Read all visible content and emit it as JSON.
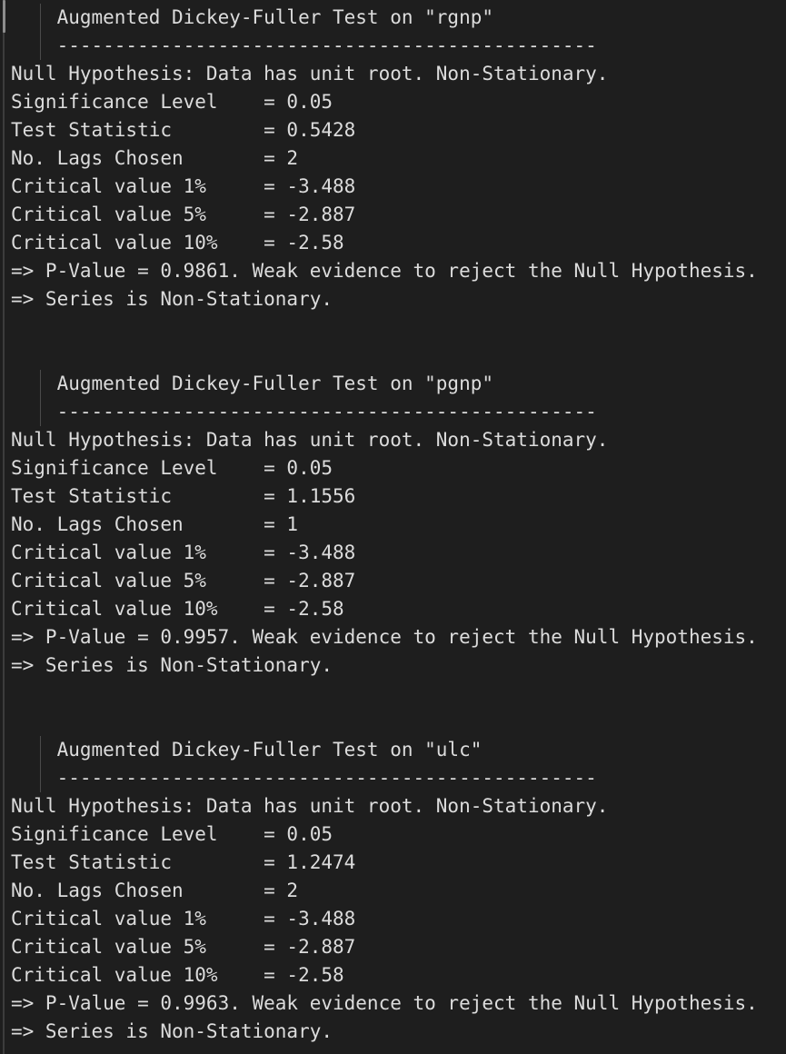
{
  "theme": {
    "background": "#1e1e1e",
    "text_color": "#dcdcdc",
    "rail_color": "#3c3c3c",
    "rail_active_color": "#8d8d8d",
    "guide_color": "#4a4a4a"
  },
  "output": {
    "blocks": [
      {
        "title": "    Augmented Dickey-Fuller Test on \"rgnp\"",
        "rule": "    -----------------------------------------------",
        "rows": [
          "Null Hypothesis: Data has unit root. Non-Stationary.",
          "Significance Level    = 0.05",
          "Test Statistic        = 0.5428",
          "No. Lags Chosen       = 2",
          "Critical value 1%     = -3.488",
          "Critical value 5%     = -2.887",
          "Critical value 10%    = -2.58",
          "=> P-Value = 0.9861. Weak evidence to reject the Null Hypothesis.",
          "=> Series is Non-Stationary."
        ],
        "fields": {
          "series": "rgnp",
          "null_hypothesis": "Data has unit root. Non-Stationary.",
          "significance_level": "0.05",
          "test_statistic": "0.5428",
          "no_lags_chosen": "2",
          "critical_value_1pct": "-3.488",
          "critical_value_5pct": "-2.887",
          "critical_value_10pct": "-2.58",
          "p_value": "0.9861",
          "conclusion_evidence": "Weak evidence to reject the Null Hypothesis.",
          "conclusion_series": "Series is Non-Stationary."
        }
      },
      {
        "title": "    Augmented Dickey-Fuller Test on \"pgnp\"",
        "rule": "    -----------------------------------------------",
        "rows": [
          "Null Hypothesis: Data has unit root. Non-Stationary.",
          "Significance Level    = 0.05",
          "Test Statistic        = 1.1556",
          "No. Lags Chosen       = 1",
          "Critical value 1%     = -3.488",
          "Critical value 5%     = -2.887",
          "Critical value 10%    = -2.58",
          "=> P-Value = 0.9957. Weak evidence to reject the Null Hypothesis.",
          "=> Series is Non-Stationary."
        ],
        "fields": {
          "series": "pgnp",
          "null_hypothesis": "Data has unit root. Non-Stationary.",
          "significance_level": "0.05",
          "test_statistic": "1.1556",
          "no_lags_chosen": "1",
          "critical_value_1pct": "-3.488",
          "critical_value_5pct": "-2.887",
          "critical_value_10pct": "-2.58",
          "p_value": "0.9957",
          "conclusion_evidence": "Weak evidence to reject the Null Hypothesis.",
          "conclusion_series": "Series is Non-Stationary."
        }
      },
      {
        "title": "    Augmented Dickey-Fuller Test on \"ulc\"",
        "rule": "    -----------------------------------------------",
        "rows": [
          "Null Hypothesis: Data has unit root. Non-Stationary.",
          "Significance Level    = 0.05",
          "Test Statistic        = 1.2474",
          "No. Lags Chosen       = 2",
          "Critical value 1%     = -3.488",
          "Critical value 5%     = -2.887",
          "Critical value 10%    = -2.58",
          "=> P-Value = 0.9963. Weak evidence to reject the Null Hypothesis.",
          "=> Series is Non-Stationary."
        ],
        "fields": {
          "series": "ulc",
          "null_hypothesis": "Data has unit root. Non-Stationary.",
          "significance_level": "0.05",
          "test_statistic": "1.2474",
          "no_lags_chosen": "2",
          "critical_value_1pct": "-3.488",
          "critical_value_5pct": "-2.887",
          "critical_value_10pct": "-2.58",
          "p_value": "0.9963",
          "conclusion_evidence": "Weak evidence to reject the Null Hypothesis.",
          "conclusion_series": "Series is Non-Stationary."
        }
      }
    ],
    "block_gap_lines": 2
  }
}
